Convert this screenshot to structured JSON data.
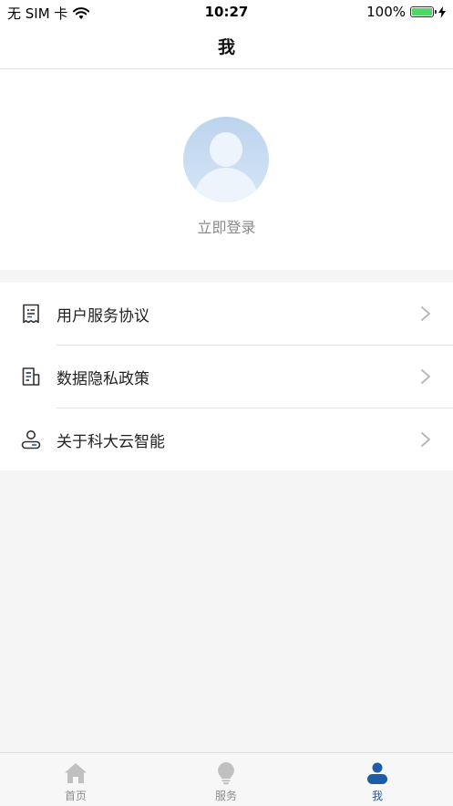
{
  "status_bar": {
    "carrier": "无 SIM 卡",
    "time": "10:27",
    "battery_percent": "100%",
    "battery_level": 1.0
  },
  "navbar": {
    "title": "我"
  },
  "profile": {
    "login_text": "立即登录",
    "avatar_icon": "default-user-avatar"
  },
  "menu": {
    "items": [
      {
        "label": "用户服务协议",
        "icon": "document-icon"
      },
      {
        "label": "数据隐私政策",
        "icon": "privacy-document-icon"
      },
      {
        "label": "关于科大云智能",
        "icon": "user-info-icon"
      }
    ]
  },
  "tabbar": {
    "tabs": [
      {
        "label": "首页",
        "icon": "home-icon",
        "active": false
      },
      {
        "label": "服务",
        "icon": "lightbulb-icon",
        "active": false
      },
      {
        "label": "我",
        "icon": "person-icon",
        "active": true
      }
    ]
  },
  "colors": {
    "accent": "#1f5ca8",
    "background": "#f5f5f5",
    "battery": "#4cd964",
    "tab_inactive": "#bdbdbd"
  }
}
